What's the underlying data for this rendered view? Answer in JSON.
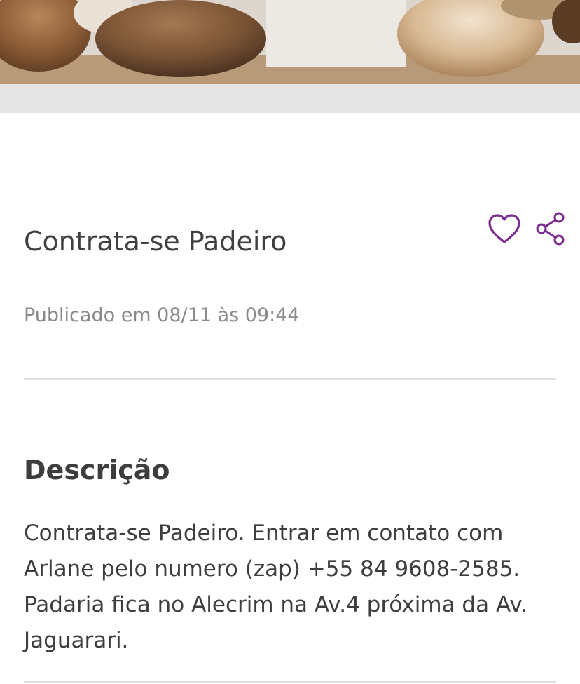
{
  "post": {
    "title": "Contrata-se Padeiro",
    "published": "Publicado em 08/11 às 09:44"
  },
  "actions": {
    "favorite_icon": "heart-icon",
    "share_icon": "share-icon",
    "accent_color": "#7b2d8e"
  },
  "description": {
    "heading": "Descrição",
    "text": "Contrata-se Padeiro. Entrar em contato com Arlane pelo numero (zap) +55 84 9608-2585. Padaria fica no Alecrim na Av.4 próxima da Av. Jaguarari."
  }
}
